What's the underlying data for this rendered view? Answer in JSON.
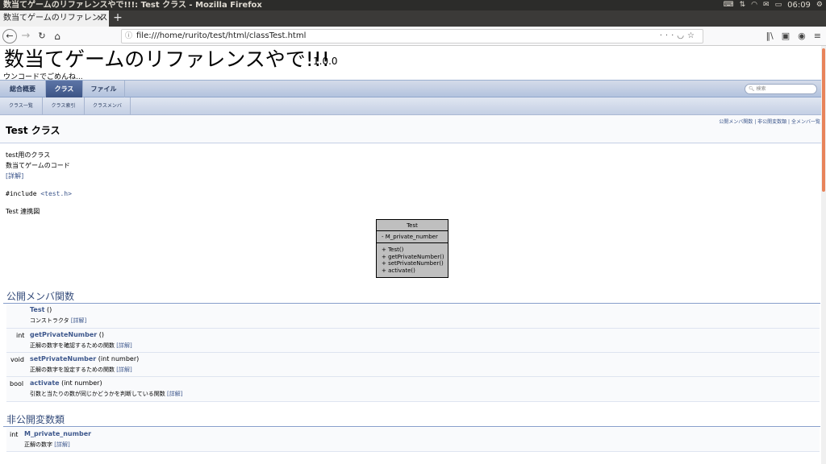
{
  "os": {
    "window_title": "数当てゲームのリファレンスやで!!!: Test クラス - Mozilla Firefox",
    "clock": "06:09"
  },
  "browser": {
    "tab_title": "数当てゲームのリファレンス",
    "url": "file:///home/rurito/test/html/classTest.html"
  },
  "project": {
    "name": "数当てゲームのリファレンスやで!!!",
    "number": "1.0.0",
    "brief": "ウンコードでごめんね..."
  },
  "tabs1": {
    "overview": "総合概要",
    "classes": "クラス",
    "files": "ファイル",
    "search_placeholder": "検索"
  },
  "tabs2": {
    "list": "クラス一覧",
    "index": "クラス索引",
    "members": "クラスメンバ"
  },
  "header": {
    "title": "Test クラス",
    "summary_public": "公開メンバ関数",
    "summary_sep1": " | ",
    "summary_private": "非公開変数類",
    "summary_sep2": " | ",
    "summary_all": "全メンバ一覧"
  },
  "description": {
    "line1": "test用のクラス",
    "line2": "数当てゲームのコード",
    "more": "[詳解]",
    "include_prefix": "#include ",
    "include_file": "<test.h>",
    "collab_title": "Test 連携図"
  },
  "uml": {
    "name": "Test",
    "attribute": "- M_private_number",
    "methods": [
      "+ Test()",
      "+ getPrivateNumber()",
      "+ setPrivateNumber()",
      "+ activate()"
    ]
  },
  "public_functions": {
    "title": "公開メンバ関数",
    "rows": [
      {
        "type": "",
        "name": "Test",
        "args": " ()",
        "desc": "コンストラクタ ",
        "more": "[詳解]"
      },
      {
        "type": "int",
        "name": "getPrivateNumber",
        "args": " ()",
        "desc": "正解の数字を確認するための関数 ",
        "more": "[詳解]"
      },
      {
        "type": "void",
        "name": "setPrivateNumber",
        "args": " (int number)",
        "desc": "正解の数字を設定するための関数 ",
        "more": "[詳解]"
      },
      {
        "type": "bool",
        "name": "activate",
        "args": " (int number)",
        "desc": "引数と当たりの数が同じかどうかを判断している関数 ",
        "more": "[詳解]"
      }
    ]
  },
  "private_vars": {
    "title": "非公開変数類",
    "rows": [
      {
        "type": "int",
        "name": "M_private_number",
        "desc": "正解の数字 ",
        "more": "[詳解]"
      }
    ]
  }
}
